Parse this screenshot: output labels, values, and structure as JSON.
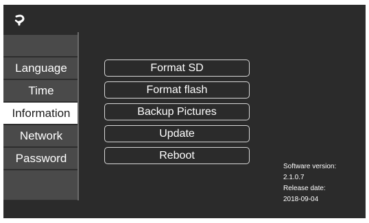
{
  "sidebar": {
    "items": [
      {
        "label": ""
      },
      {
        "label": "Language"
      },
      {
        "label": "Time"
      },
      {
        "label": "Information"
      },
      {
        "label": "Network"
      },
      {
        "label": "Password"
      },
      {
        "label": ""
      }
    ],
    "selected": "Information"
  },
  "actions": {
    "format_sd": "Format SD",
    "format_flash": "Format flash",
    "backup_pictures": "Backup Pictures",
    "update": "Update",
    "reboot": "Reboot"
  },
  "info": {
    "software_version_label": "Software version:",
    "software_version": "2.1.0.7",
    "release_date_label": "Release date:",
    "release_date": "2018-09-04"
  },
  "icons": {
    "back": "back-arrow-icon"
  },
  "colors": {
    "background": "#2b2b2b",
    "sidebar_item": "#4a4a4a",
    "selected": "#ffffff"
  }
}
